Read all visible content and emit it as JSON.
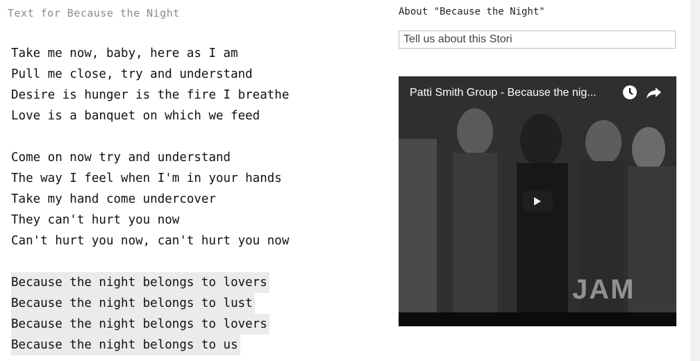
{
  "lyrics_panel": {
    "title": "Text for Because the Night",
    "verses": [
      [
        "Take me now, baby, here as I am",
        "Pull me close, try and understand",
        "Desire is hunger is the fire I breathe",
        "Love is a banquet on which we feed"
      ],
      [
        "Come on now try and understand",
        "The way I feel when I'm in your hands",
        "Take my hand come undercover",
        "They can't hurt you now",
        "Can't hurt you now, can't hurt you now"
      ],
      [
        "Because the night belongs to lovers",
        "Because the night belongs to lust",
        "Because the night belongs to lovers",
        "Because the night belongs to us"
      ]
    ]
  },
  "about_panel": {
    "title": "About \"Because the Night\"",
    "input_value": "Tell us about this Stori"
  },
  "video": {
    "title": "Patti Smith Group - Because the nig...",
    "watermark": "JAM"
  }
}
